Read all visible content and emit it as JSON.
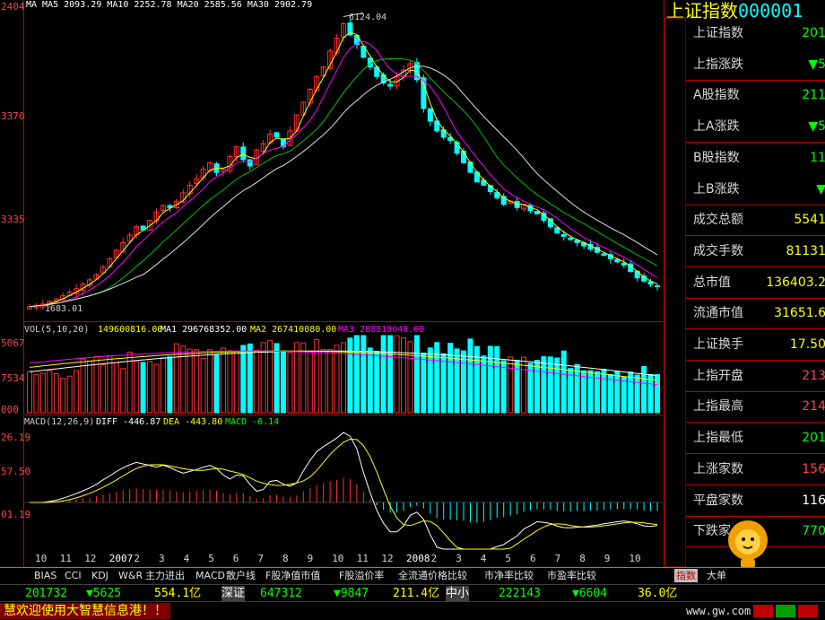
{
  "legends": {
    "ma_line": "MA MA5 2093.29 MA10 2252.78 MA20 2585.56 MA30 2902.79",
    "vol_prefix": "VOL(5,10,20)",
    "vol_value": "149600816.00",
    "vol_ma1": "MA1 296768352.00",
    "vol_ma2": "MA2 267410080.00",
    "vol_ma3": "MA3 288818048.00",
    "macd_prefix": "MACD(12,26,9)",
    "macd_diff": "DIFF -446.87",
    "macd_dea": "DEA -443.80",
    "macd_val": "MACD -6.14"
  },
  "left_axis": {
    "main_top": "2404",
    "main_mid": "3370",
    "main_low": "3335",
    "vol_top": "5067",
    "vol_mid": "7534",
    "vol_low": "000",
    "macd_top": "26.19",
    "macd_mid": "57.50",
    "macd_low": "01.19"
  },
  "annotations": {
    "peak": "6124.04",
    "low": "1683.01"
  },
  "x_axis_ticks": [
    "10",
    "11",
    "12",
    "2007",
    "2",
    "3",
    "4",
    "5",
    "6",
    "7",
    "8",
    "9",
    "10",
    "11",
    "12",
    "2008",
    "2",
    "3",
    "4",
    "5",
    "6",
    "7",
    "8",
    "9",
    "10"
  ],
  "tabs": [
    "BIAS",
    "CCI",
    "KDJ",
    "W&R",
    "主力进出",
    "MACD",
    "散户线",
    "F股净值市值",
    "F股溢价率",
    "全流通价格比较",
    "市净率比较",
    "市盈率比较"
  ],
  "right_tabs": [
    "指数",
    "大单"
  ],
  "right_panel": {
    "title": "上证指数",
    "code": "000001",
    "rows": [
      {
        "label": "上证指数",
        "value": "201",
        "color": "#00ff00"
      },
      {
        "label": "上指涨跌",
        "value": "▼5",
        "color": "#00ff00"
      },
      {
        "label": "A股指数",
        "value": "211",
        "color": "#00ff00"
      },
      {
        "label": "上A涨跌",
        "value": "▼5",
        "color": "#00ff00"
      },
      {
        "label": "B股指数",
        "value": "11",
        "color": "#00ff00"
      },
      {
        "label": "上B涨跌",
        "value": "▼",
        "color": "#00ff00"
      },
      {
        "label": "成交总额",
        "value": "5541",
        "color": "#ffff00"
      },
      {
        "label": "成交手数",
        "value": "81131",
        "color": "#ffff00"
      },
      {
        "label": "总市值",
        "value": "136403.2",
        "color": "#ffff00"
      },
      {
        "label": "流通市值",
        "value": "31651.6",
        "color": "#ffff00"
      },
      {
        "label": "上证换手",
        "value": "17.50",
        "color": "#ffff00"
      },
      {
        "label": "上指开盘",
        "value": "213",
        "color": "#ff4040"
      },
      {
        "label": "上指最高",
        "value": "214",
        "color": "#ff4040"
      },
      {
        "label": "上指最低",
        "value": "201",
        "color": "#00ff00"
      },
      {
        "label": "上涨家数",
        "value": "156",
        "color": "#ff4040"
      },
      {
        "label": "平盘家数",
        "value": "116",
        "color": "#ffffff"
      },
      {
        "label": "下跌家",
        "value": "770",
        "color": "#00ff00"
      }
    ]
  },
  "status_bar": {
    "sh_index": "201732",
    "sh_change": "▼5625",
    "sh_amount": "554.1亿",
    "sz_label": "深证",
    "sz_index": "647312",
    "sz_change": "▼9847",
    "sz_amount": "211.4亿",
    "zx_label": "中小",
    "zx_index": "222143",
    "zx_change": "▼6604",
    "zx_amount": "36.0亿",
    "website": "www.gw.com.cn"
  },
  "marquee": "慧欢迎使用大智慧信息港！！",
  "colors": {
    "up": "#ff3030",
    "down": "#00ffff",
    "ma5": "#ffff00",
    "ma10": "#ff00ff",
    "ma20": "#00c000",
    "ma30": "#e0e0e0",
    "grid": "#c00000"
  },
  "chart_data": {
    "type": "candlestick",
    "price": [
      1700,
      1720,
      1740,
      1780,
      1820,
      1870,
      1930,
      1980,
      2050,
      2120,
      2200,
      2320,
      2450,
      2580,
      2700,
      2820,
      2950,
      2900,
      3050,
      3180,
      3280,
      3250,
      3350,
      3480,
      3600,
      3700,
      3850,
      3950,
      3800,
      3850,
      4050,
      4200,
      4000,
      3900,
      4150,
      4250,
      4400,
      4350,
      4200,
      4450,
      4700,
      4900,
      5100,
      5300,
      5450,
      5700,
      5900,
      6124,
      5950,
      5800,
      5600,
      5450,
      5300,
      5200,
      5150,
      5300,
      5400,
      5500,
      5250,
      4800,
      4600,
      4450,
      4350,
      4300,
      4100,
      3950,
      3800,
      3650,
      3600,
      3500,
      3400,
      3300,
      3350,
      3250,
      3300,
      3200,
      3150,
      3050,
      2950,
      2850,
      2800,
      2750,
      2700,
      2650,
      2600,
      2550,
      2500,
      2450,
      2400,
      2350,
      2250,
      2150,
      2100,
      2050,
      2017
    ]
  }
}
